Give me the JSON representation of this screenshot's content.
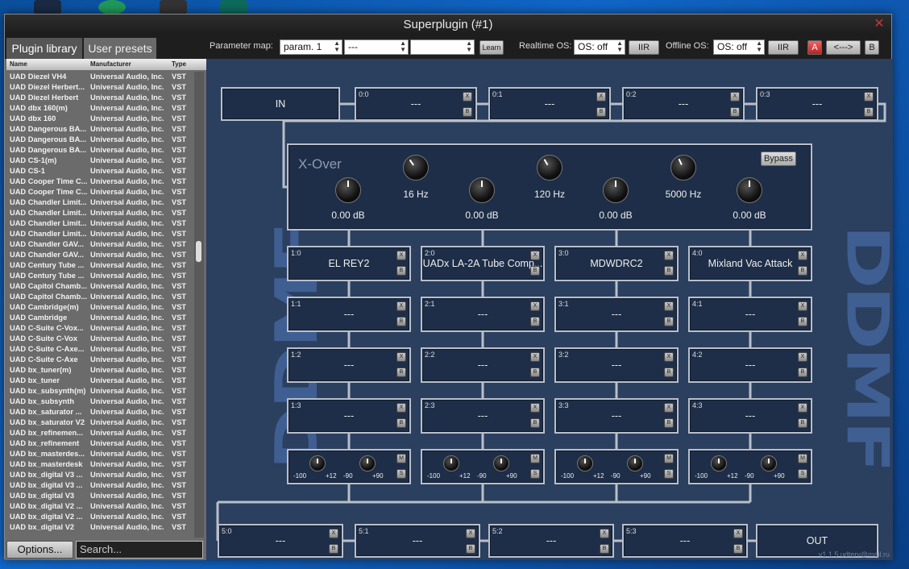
{
  "window": {
    "title": "Superplugin (#1)",
    "close_icon": "close-icon"
  },
  "tabs": {
    "library": "Plugin library",
    "presets": "User presets"
  },
  "toolbar": {
    "param_map_label": "Parameter map:",
    "param1": "param. 1",
    "param2": "---",
    "param3": "",
    "learn": "Learn",
    "realtime_label": "Realtime OS:",
    "realtime_value": "OS: off",
    "iir1": "IIR",
    "offline_label": "Offline OS:",
    "offline_value": "OS: off",
    "iir2": "IIR",
    "a": "A",
    "swap": "<--->",
    "b": "B"
  },
  "list": {
    "headers": [
      "Name",
      "Manufacturer",
      "Type"
    ],
    "rows": [
      [
        "UAD Diezel VH4",
        "Universal Audio, Inc.",
        "VST"
      ],
      [
        "UAD Diezel Herbert...",
        "Universal Audio, Inc.",
        "VST"
      ],
      [
        "UAD Diezel Herbert",
        "Universal Audio, Inc.",
        "VST"
      ],
      [
        "UAD dbx 160(m)",
        "Universal Audio, Inc.",
        "VST"
      ],
      [
        "UAD dbx 160",
        "Universal Audio, Inc.",
        "VST"
      ],
      [
        "UAD Dangerous BA...",
        "Universal Audio, Inc.",
        "VST"
      ],
      [
        "UAD Dangerous BA...",
        "Universal Audio, Inc.",
        "VST"
      ],
      [
        "UAD Dangerous BA...",
        "Universal Audio, Inc.",
        "VST"
      ],
      [
        "UAD CS-1(m)",
        "Universal Audio, Inc.",
        "VST"
      ],
      [
        "UAD CS-1",
        "Universal Audio, Inc.",
        "VST"
      ],
      [
        "UAD Cooper Time C...",
        "Universal Audio, Inc.",
        "VST"
      ],
      [
        "UAD Cooper Time C...",
        "Universal Audio, Inc.",
        "VST"
      ],
      [
        "UAD Chandler Limit...",
        "Universal Audio, Inc.",
        "VST"
      ],
      [
        "UAD Chandler Limit...",
        "Universal Audio, Inc.",
        "VST"
      ],
      [
        "UAD Chandler Limit...",
        "Universal Audio, Inc.",
        "VST"
      ],
      [
        "UAD Chandler Limit...",
        "Universal Audio, Inc.",
        "VST"
      ],
      [
        "UAD Chandler GAV...",
        "Universal Audio, Inc.",
        "VST"
      ],
      [
        "UAD Chandler GAV...",
        "Universal Audio, Inc.",
        "VST"
      ],
      [
        "UAD Century Tube ...",
        "Universal Audio, Inc.",
        "VST"
      ],
      [
        "UAD Century Tube ...",
        "Universal Audio, Inc.",
        "VST"
      ],
      [
        "UAD Capitol Chamb...",
        "Universal Audio, Inc.",
        "VST"
      ],
      [
        "UAD Capitol Chamb...",
        "Universal Audio, Inc.",
        "VST"
      ],
      [
        "UAD Cambridge(m)",
        "Universal Audio, Inc.",
        "VST"
      ],
      [
        "UAD Cambridge",
        "Universal Audio, Inc.",
        "VST"
      ],
      [
        "UAD C-Suite C-Vox...",
        "Universal Audio, Inc.",
        "VST"
      ],
      [
        "UAD C-Suite C-Vox",
        "Universal Audio, Inc.",
        "VST"
      ],
      [
        "UAD C-Suite C-Axe...",
        "Universal Audio, Inc.",
        "VST"
      ],
      [
        "UAD C-Suite C-Axe",
        "Universal Audio, Inc.",
        "VST"
      ],
      [
        "UAD bx_tuner(m)",
        "Universal Audio, Inc.",
        "VST"
      ],
      [
        "UAD bx_tuner",
        "Universal Audio, Inc.",
        "VST"
      ],
      [
        "UAD bx_subsynth(m)",
        "Universal Audio, Inc.",
        "VST"
      ],
      [
        "UAD bx_subsynth",
        "Universal Audio, Inc.",
        "VST"
      ],
      [
        "UAD bx_saturator ...",
        "Universal Audio, Inc.",
        "VST"
      ],
      [
        "UAD bx_saturator V2",
        "Universal Audio, Inc.",
        "VST"
      ],
      [
        "UAD bx_refinemen...",
        "Universal Audio, Inc.",
        "VST"
      ],
      [
        "UAD bx_refinement",
        "Universal Audio, Inc.",
        "VST"
      ],
      [
        "UAD bx_masterdes...",
        "Universal Audio, Inc.",
        "VST"
      ],
      [
        "UAD bx_masterdesk",
        "Universal Audio, Inc.",
        "VST"
      ],
      [
        "UAD bx_digital V3 ...",
        "Universal Audio, Inc.",
        "VST"
      ],
      [
        "UAD bx_digital V3 ...",
        "Universal Audio, Inc.",
        "VST"
      ],
      [
        "UAD bx_digital V3",
        "Universal Audio, Inc.",
        "VST"
      ],
      [
        "UAD bx_digital V2 ...",
        "Universal Audio, Inc.",
        "VST"
      ],
      [
        "UAD bx_digital V2 ...",
        "Universal Audio, Inc.",
        "VST"
      ],
      [
        "UAD bx_digital V2",
        "Universal Audio, Inc.",
        "VST"
      ]
    ]
  },
  "options_button": "Options...",
  "search_placeholder": "Search...",
  "logo_text": "DDMF",
  "chain": {
    "in": "IN",
    "out": "OUT",
    "top": [
      {
        "id": "0:0",
        "name": "---"
      },
      {
        "id": "0:1",
        "name": "---"
      },
      {
        "id": "0:2",
        "name": "---"
      },
      {
        "id": "0:3",
        "name": "---"
      }
    ],
    "bottom": [
      {
        "id": "5:0",
        "name": "---"
      },
      {
        "id": "5:1",
        "name": "---"
      },
      {
        "id": "5:2",
        "name": "---"
      },
      {
        "id": "5:3",
        "name": "---"
      }
    ],
    "bands": [
      [
        {
          "id": "1:0",
          "name": "EL REY2"
        },
        {
          "id": "1:1",
          "name": "---"
        },
        {
          "id": "1:2",
          "name": "---"
        },
        {
          "id": "1:3",
          "name": "---"
        }
      ],
      [
        {
          "id": "2:0",
          "name": "UADx LA-2A Tube Comp..."
        },
        {
          "id": "2:1",
          "name": "---"
        },
        {
          "id": "2:2",
          "name": "---"
        },
        {
          "id": "2:3",
          "name": "---"
        }
      ],
      [
        {
          "id": "3:0",
          "name": "MDWDRC2"
        },
        {
          "id": "3:1",
          "name": "---"
        },
        {
          "id": "3:2",
          "name": "---"
        },
        {
          "id": "3:3",
          "name": "---"
        }
      ],
      [
        {
          "id": "4:0",
          "name": "Mixland Vac Attack"
        },
        {
          "id": "4:1",
          "name": "---"
        },
        {
          "id": "4:2",
          "name": "---"
        },
        {
          "id": "4:3",
          "name": "---"
        }
      ]
    ],
    "mini_x": "X",
    "mini_b": "B",
    "mini_m": "M",
    "mini_s": "S",
    "gain": {
      "min": "-100",
      "max": "+12",
      "pan_min": "-90",
      "pan_max": "+90"
    }
  },
  "xover": {
    "title": "X-Over",
    "bypass": "Bypass",
    "freqs": [
      "16 Hz",
      "120 Hz",
      "5000 Hz"
    ],
    "gains": [
      "0.00 dB",
      "0.00 dB",
      "0.00 dB",
      "0.00 dB"
    ]
  },
  "version": "v1.1.5 udterv@mail.ru"
}
